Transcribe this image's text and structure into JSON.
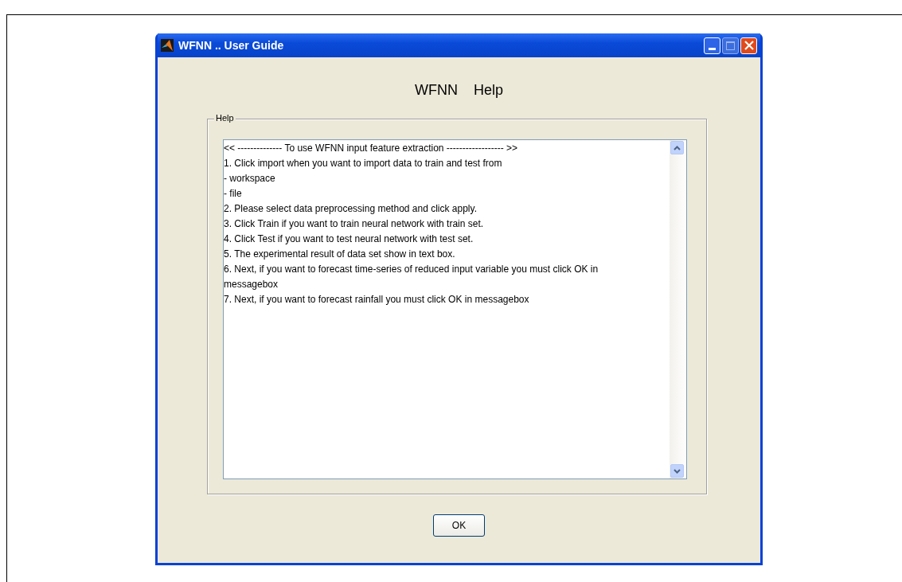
{
  "window": {
    "title": "WFNN .. User Guide"
  },
  "heading": "WFNN    Help",
  "help_panel": {
    "label": "Help",
    "lines": [
      "<< -------------- To use WFNN input feature extraction ------------------ >>",
      "1. Click import when you want to import data to train and test from",
      "- workspace",
      "- file",
      "2. Please select data preprocessing method and click apply.",
      "3. Click Train if you want to train neural network with train set.",
      "4. Click Test if you want to test neural network with test set.",
      "5. The experimental result of data set show in text box.",
      "6. Next, if you want to forecast time-series of reduced input variable you must click OK in",
      "messagebox",
      "7. Next, if you want to forecast rainfall you must click OK in messagebox"
    ]
  },
  "buttons": [
    "OK"
  ]
}
